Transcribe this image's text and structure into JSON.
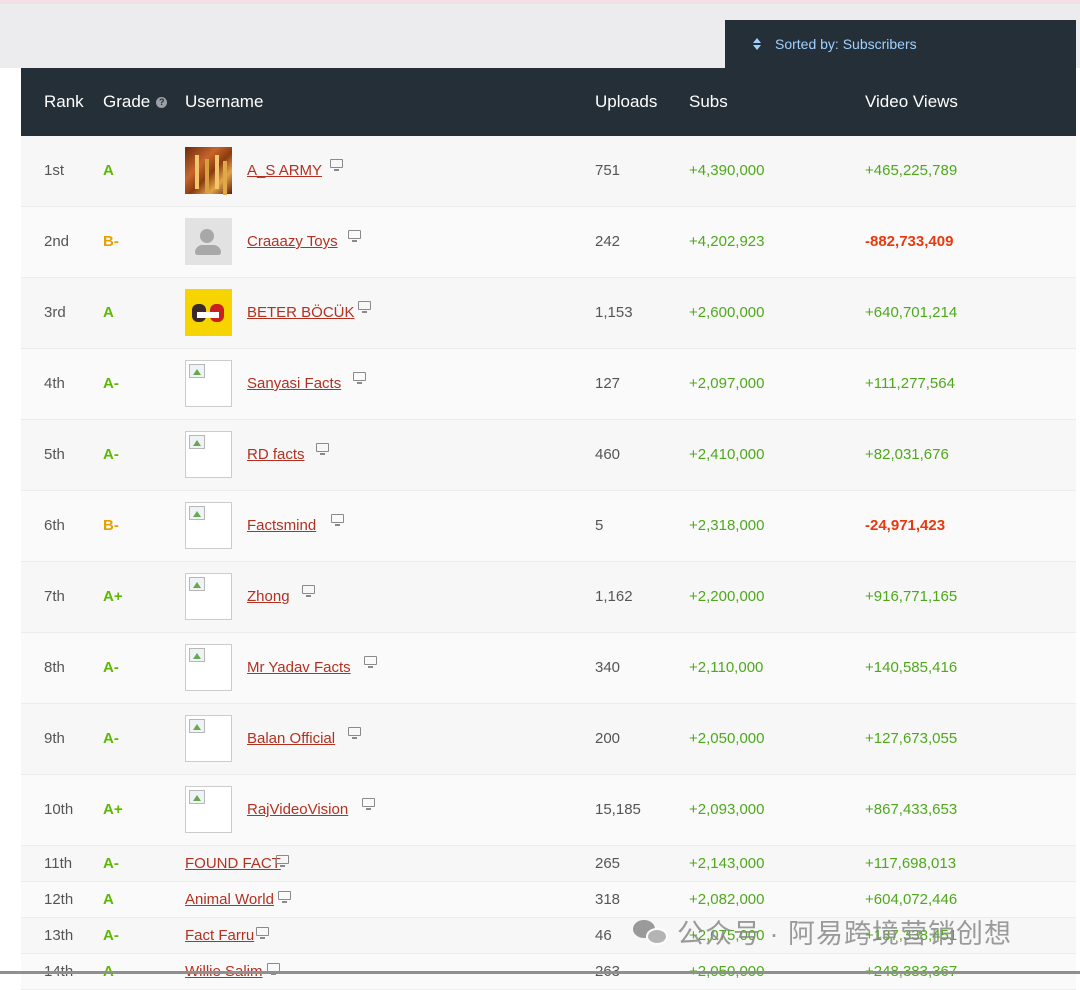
{
  "sort": {
    "label": "Sorted by: Subscribers"
  },
  "headers": {
    "rank": "Rank",
    "grade": "Grade",
    "username": "Username",
    "uploads": "Uploads",
    "subs": "Subs",
    "views": "Video Views"
  },
  "rows": [
    {
      "rank": "1st",
      "grade": "A",
      "username": "A_S ARMY",
      "uploads": "751",
      "subs": "+4,390,000",
      "views": "+465,225,789"
    },
    {
      "rank": "2nd",
      "grade": "B-",
      "username": "Craaazy Toys",
      "uploads": "242",
      "subs": "+4,202,923",
      "views": "-882,733,409"
    },
    {
      "rank": "3rd",
      "grade": "A",
      "username": "BETER BÖCÜK",
      "uploads": "1,153",
      "subs": "+2,600,000",
      "views": "+640,701,214"
    },
    {
      "rank": "4th",
      "grade": "A-",
      "username": "Sanyasi Facts",
      "uploads": "127",
      "subs": "+2,097,000",
      "views": "+111,277,564"
    },
    {
      "rank": "5th",
      "grade": "A-",
      "username": "RD facts",
      "uploads": "460",
      "subs": "+2,410,000",
      "views": "+82,031,676"
    },
    {
      "rank": "6th",
      "grade": "B-",
      "username": "Factsmind",
      "uploads": "5",
      "subs": "+2,318,000",
      "views": "-24,971,423"
    },
    {
      "rank": "7th",
      "grade": "A+",
      "username": "Zhong",
      "uploads": "1,162",
      "subs": "+2,200,000",
      "views": "+916,771,165"
    },
    {
      "rank": "8th",
      "grade": "A-",
      "username": "Mr Yadav Facts",
      "uploads": "340",
      "subs": "+2,110,000",
      "views": "+140,585,416"
    },
    {
      "rank": "9th",
      "grade": "A-",
      "username": "Balan Official",
      "uploads": "200",
      "subs": "+2,050,000",
      "views": "+127,673,055"
    },
    {
      "rank": "10th",
      "grade": "A+",
      "username": "RajVideoVision",
      "uploads": "15,185",
      "subs": "+2,093,000",
      "views": "+867,433,653"
    },
    {
      "rank": "11th",
      "grade": "A-",
      "username": "FOUND FACT",
      "uploads": "265",
      "subs": "+2,143,000",
      "views": "+117,698,013"
    },
    {
      "rank": "12th",
      "grade": "A",
      "username": "Animal World",
      "uploads": "318",
      "subs": "+2,082,000",
      "views": "+604,072,446"
    },
    {
      "rank": "13th",
      "grade": "A-",
      "username": "Fact Farru",
      "uploads": "46",
      "subs": "+2,075,000",
      "views": "+137,338,451"
    },
    {
      "rank": "14th",
      "grade": "A",
      "username": "Willie Salim",
      "uploads": "263",
      "subs": "+2,050,000",
      "views": "+248,383,367"
    }
  ],
  "watermark": "公众号 · 阿易跨境营销创想"
}
